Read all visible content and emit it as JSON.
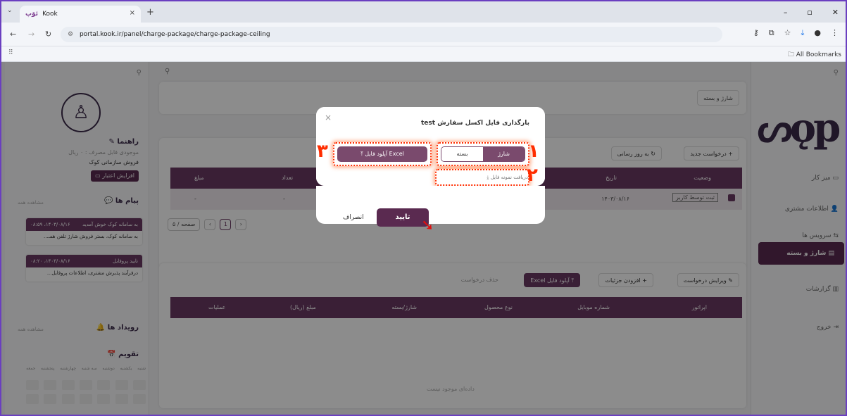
{
  "browser": {
    "tab_title": "Kook",
    "tab_favicon": "ئۆپ",
    "url": "portal.kook.ir/panel/charge-package/charge-package-ceiling",
    "all_bookmarks": "All Bookmarks"
  },
  "left_panel": {
    "guide_label": "راهنما",
    "usage_text": "موجودی قابل مصرف : ۰ ریال",
    "org_text": "فروش سازمانی کوک",
    "credit_button": "افزایش اعتبار",
    "messages_title": "پیام ها",
    "see_all": "مشاهده همه",
    "messages": [
      {
        "date": "۱۴۰۳/۰۸/۱۶، ۰۸:۵۹",
        "title": "به سامانه کوک خوش آمدید",
        "body": "به سامانه کوک، بستر فروش شارژ تلفن همـ..."
      },
      {
        "date": "۱۴۰۳/۰۸/۱۶، ۰۸:۲۰",
        "title": "تایید پروفایل",
        "body": "درفرآیند پذیرش مشتری، اطلاعات پروفایل..."
      }
    ],
    "events_title": "رویداد ها",
    "calendar_title": "تقویم",
    "weekdays": [
      "شنبه",
      "یکشنبه",
      "دوشنبه",
      "سه شنبه",
      "چهارشنبه",
      "پنجشنبه",
      "جمعه"
    ]
  },
  "main": {
    "breadcrumb": "شارژ و بسته",
    "new_request": "درخواست جدید",
    "refresh": "به روز رسانی",
    "top_table": {
      "headers": [
        "وضعیت",
        "تاریخ",
        "تعداد",
        "مبلغ"
      ],
      "row": {
        "status": "ثبت توسط کاربر",
        "date": "۱۴۰۳/۰۸/۱۶",
        "count": "-",
        "amount": "-"
      }
    },
    "pagination": {
      "page": "1",
      "per_page": "۵ / صفحه"
    },
    "bottom_toolbar": {
      "edit": "ویرایش درخواست",
      "add_details": "افزودن جزئیات",
      "upload_excel": "آپلود فایل Excel",
      "delete": "حذف درخواست"
    },
    "bottom_table": {
      "headers": [
        "اپراتور",
        "شماره موبایل",
        "نوع محصول",
        "شارژ/بسته",
        "مبلغ (ریال)",
        "عملیات"
      ],
      "empty_text": "داده‌ای موجود نیست"
    }
  },
  "right_nav": {
    "items": [
      "میز کار",
      "اطلاعات مشتری",
      "سرویس ها",
      "شارژ و بسته",
      "گزارشات",
      "خروج"
    ]
  },
  "modal": {
    "title": "بارگذاری فایل اکسل سفارش test",
    "seg_on": "شارژ",
    "seg_off": "بسته",
    "upload_button": "آپلود فایل Excel",
    "sample_link": "دریافت نمونه فایل",
    "confirm": "تایید",
    "cancel": "انصراف",
    "markers": [
      "۱",
      "۲",
      "۳"
    ]
  },
  "colors": {
    "brand": "#5a2a50",
    "highlight": "#ff2d00"
  }
}
